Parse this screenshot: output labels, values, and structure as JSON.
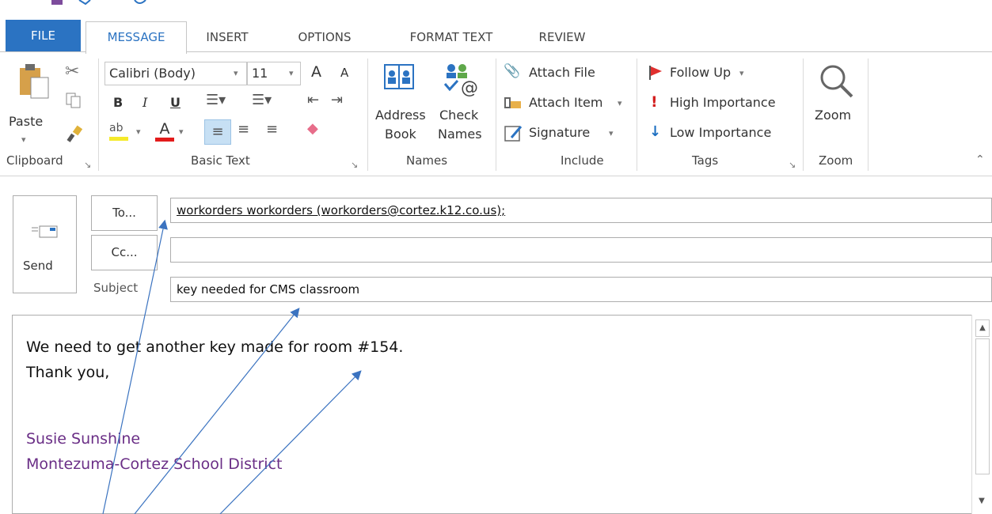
{
  "tabs": {
    "file": "FILE",
    "message": "MESSAGE",
    "insert": "INSERT",
    "options": "OPTIONS",
    "format_text": "FORMAT TEXT",
    "review": "REVIEW"
  },
  "ribbon": {
    "clipboard": {
      "paste_label": "Paste",
      "group_label": "Clipboard"
    },
    "basic_text": {
      "font_name": "Calibri (Body)",
      "font_size": "11",
      "bold": "B",
      "italic": "I",
      "underline": "U",
      "grow_font": "A",
      "shrink_font": "A",
      "font_color_letter": "A",
      "group_label": "Basic Text"
    },
    "names": {
      "address_book_line1": "Address",
      "address_book_line2": "Book",
      "check_names_line1": "Check",
      "check_names_line2": "Names",
      "group_label": "Names"
    },
    "include": {
      "attach_file": "Attach File",
      "attach_item": "Attach Item",
      "signature": "Signature",
      "group_label": "Include"
    },
    "tags": {
      "follow_up": "Follow Up",
      "high_importance": "High Importance",
      "low_importance": "Low Importance",
      "group_label": "Tags"
    },
    "zoom": {
      "zoom_label": "Zoom",
      "group_label": "Zoom"
    }
  },
  "compose": {
    "send_label": "Send",
    "to_button": "To...",
    "cc_button": "Cc...",
    "subject_label": "Subject",
    "to_value": "workorders workorders (workorders@cortez.k12.co.us);",
    "cc_value": "",
    "subject_value": "key needed for CMS classroom"
  },
  "body": {
    "line1": "We need to get another key made for room #154.",
    "line2": "Thank you,",
    "signature_name": "Susie Sunshine",
    "signature_org": "Montezuma-Cortez School District"
  },
  "colors": {
    "file_tab_bg": "#2b73c2",
    "message_tab_text": "#2b73c2",
    "signature_text": "#6a2e86",
    "follow_up_flag": "#e0302f",
    "high_importance": "#d31f1f",
    "low_importance": "#1d6fc1",
    "annotation_arrow": "#3b73c0"
  },
  "icons": {
    "paste": "paste-icon",
    "cut": "scissors-icon",
    "copy": "copy-icon",
    "format_painter": "format-painter-icon",
    "address_book": "address-book-icon",
    "check_names": "check-names-icon",
    "attach_file": "paperclip-icon",
    "attach_item": "attach-item-icon",
    "signature": "signature-icon",
    "follow_up": "flag-icon",
    "high_importance": "exclamation-icon",
    "low_importance": "down-arrow-icon",
    "zoom": "magnifier-icon",
    "send": "envelope-icon",
    "collapse_ribbon": "chevron-up-icon"
  }
}
